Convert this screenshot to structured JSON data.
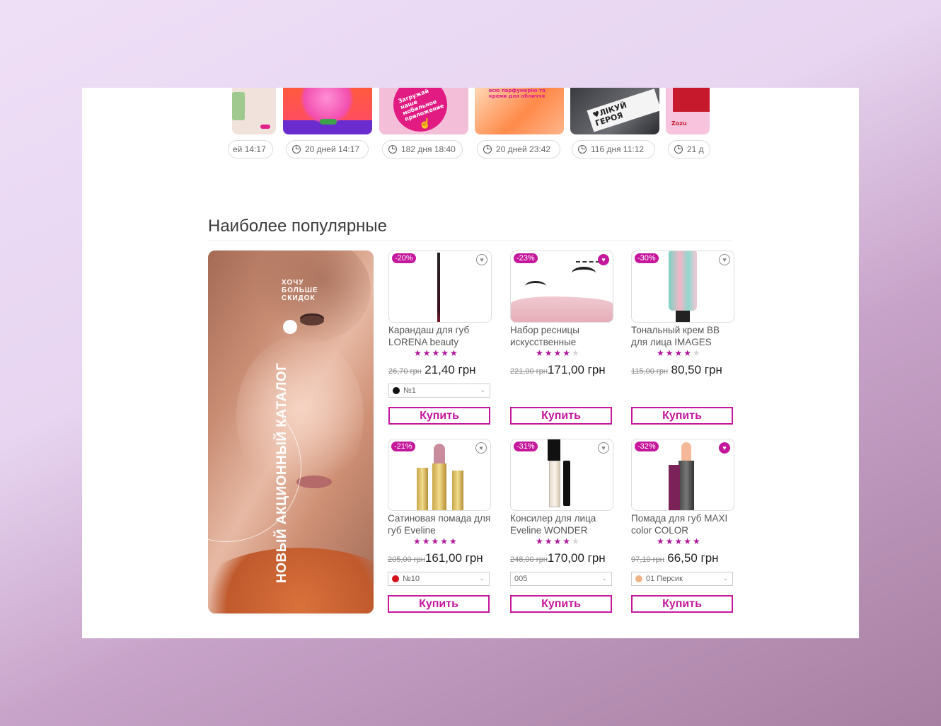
{
  "stories": [
    {
      "time": "ей 14:17"
    },
    {
      "time": "20 дней 14:17"
    },
    {
      "time": "182 дня 18:40",
      "art_text": "Загружай наше мобильное приложение"
    },
    {
      "time": "20 дней 23:42",
      "art_text": "всю парфумерію та креми для обличчя"
    },
    {
      "time": "116 дня 11:12",
      "art_text": "♥ЛІКУЙ ГЕРОЯ"
    },
    {
      "time": "21 д",
      "art_text": "Zozu"
    }
  ],
  "section_title": "Наиболее популярные",
  "promo": {
    "small_text": "ХОЧУ\nБОЛЬШЕ\nСКИДОК",
    "vertical_text": "НОВЫЙ АКЦИОННЫЙ КАТАЛОГ"
  },
  "products": [
    {
      "discount": "-20%",
      "name": "Карандаш для губ LORENA beauty",
      "rating": 5,
      "old_price": "26,70 грн",
      "new_price": "21,40 грн",
      "option": "№1",
      "option_color": "#111111",
      "favorite": false,
      "buy": "Купить"
    },
    {
      "discount": "-23%",
      "name": "Набор ресницы искусственные",
      "rating": 4,
      "old_price": "221,00 грн",
      "new_price": "171,00 грн",
      "option": "",
      "favorite": true,
      "buy": "Купить"
    },
    {
      "discount": "-30%",
      "name": "Тональный крем BB для лица IMAGES",
      "rating": 4,
      "old_price": "115,00 грн",
      "new_price": "80,50 грн",
      "option": "",
      "favorite": false,
      "buy": "Купить"
    },
    {
      "discount": "-21%",
      "name": "Сатиновая помада для губ Eveline",
      "rating": 5,
      "old_price": "205,00 грн",
      "new_price": "161,00 грн",
      "option": "№10",
      "option_color": "#d4101a",
      "favorite": false,
      "buy": "Купить"
    },
    {
      "discount": "-31%",
      "name": "Консилер для лица Eveline WONDER",
      "rating": 4,
      "old_price": "248,00 грн",
      "new_price": "170,00 грн",
      "option": "005",
      "favorite": false,
      "buy": "Купить"
    },
    {
      "discount": "-32%",
      "name": "Помада для губ MAXI color COLOR",
      "rating": 5,
      "old_price": "97,10 грн",
      "new_price": "66,50 грн",
      "option": "01 Персик",
      "option_color": "#f0b287",
      "favorite": true,
      "buy": "Купить"
    }
  ],
  "colors": {
    "accent": "#c5179c"
  }
}
